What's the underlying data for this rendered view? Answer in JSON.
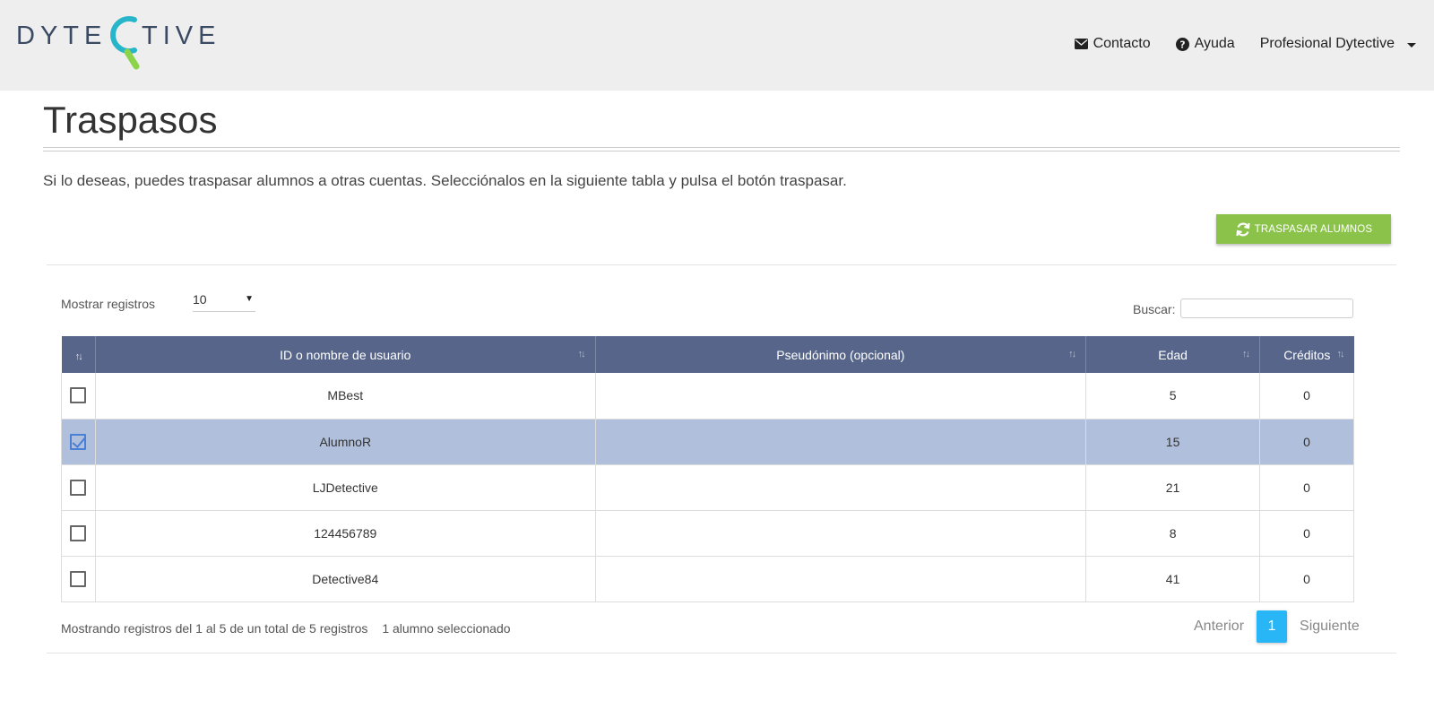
{
  "header": {
    "logo_text_left": "DYTE",
    "logo_text_right": "TIVE",
    "nav": {
      "contact": "Contacto",
      "help": "Ayuda",
      "user": "Profesional Dytective"
    }
  },
  "page": {
    "title": "Traspasos",
    "intro": "Si lo deseas, puedes traspasar alumnos a otras cuentas. Selecciónalos en la siguiente tabla y pulsa el botón traspasar.",
    "transfer_button": "TRASPASAR ALUMNOS"
  },
  "table_controls": {
    "length_label": "Mostrar registros",
    "length_value": "10",
    "search_label": "Buscar:",
    "search_value": ""
  },
  "table": {
    "headers": [
      "ID o nombre de usuario",
      "Pseudónimo (opcional)",
      "Edad",
      "Créditos"
    ],
    "rows": [
      {
        "checked": false,
        "id": "MBest",
        "alias": "",
        "age": "5",
        "credits": "0"
      },
      {
        "checked": true,
        "id": "AlumnoR",
        "alias": "",
        "age": "15",
        "credits": "0"
      },
      {
        "checked": false,
        "id": "LJDetective",
        "alias": "",
        "age": "21",
        "credits": "0"
      },
      {
        "checked": false,
        "id": "124456789",
        "alias": "",
        "age": "8",
        "credits": "0"
      },
      {
        "checked": false,
        "id": "Detective84",
        "alias": "",
        "age": "41",
        "credits": "0"
      }
    ]
  },
  "footer": {
    "info": "Mostrando registros del 1 al 5 de un total de 5 registros",
    "selected_info": "1 alumno seleccionado",
    "prev": "Anterior",
    "current_page": "1",
    "next": "Siguiente"
  },
  "colors": {
    "header_bg": "#eeeeee",
    "table_header": "#566589",
    "selected_row": "#b0bfdb",
    "button_green": "#8bc34a",
    "page_active": "#29b6f6",
    "logo_green": "#8bd449",
    "logo_teal": "#27b6c9"
  }
}
